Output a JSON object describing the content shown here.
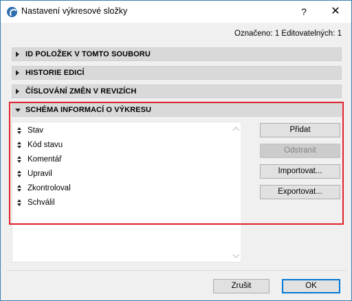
{
  "window": {
    "title": "Nastavení výkresové složky",
    "help_label": "?",
    "close_label": "✕"
  },
  "selected_info": "Označeno: 1 Editovatelných: 1",
  "sections": [
    {
      "label": "ID POLOŽEK V TOMTO SOUBORU",
      "expanded": false
    },
    {
      "label": "HISTORIE EDICÍ",
      "expanded": false
    },
    {
      "label": "ČÍSLOVÁNÍ ZMĚN V REVIZÍCH",
      "expanded": false
    },
    {
      "label": "SCHÉMA INFORMACÍ O VÝKRESU",
      "expanded": true
    }
  ],
  "schema_items": [
    "Stav",
    "Kód stavu",
    "Komentář",
    "Upravil",
    "Zkontroloval",
    "Schválil"
  ],
  "buttons": {
    "add": "Přidat",
    "remove": "Odstranit",
    "import": "Importovat...",
    "export": "Exportovat...",
    "cancel": "Zrušit",
    "ok": "OK"
  },
  "colors": {
    "highlight_border": "#e0202a",
    "title_border": "#3c7fb1",
    "primary_button_border": "#0078d7"
  }
}
